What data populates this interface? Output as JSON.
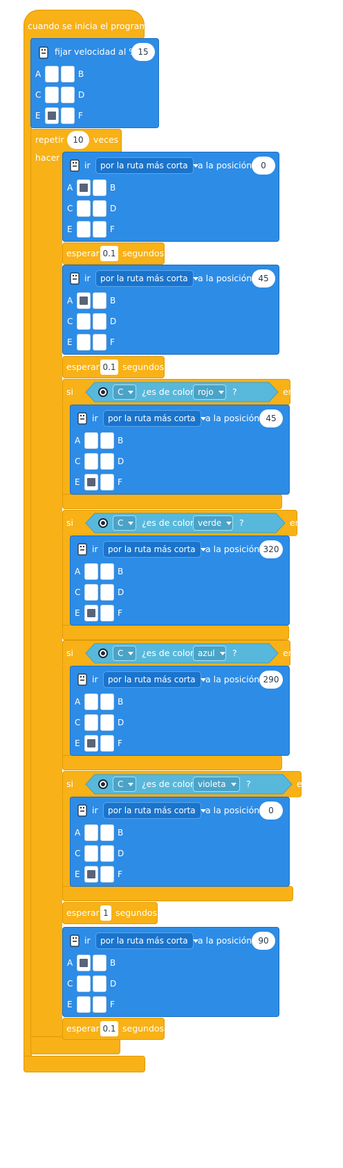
{
  "start": {
    "label": "cuando se inicia el programa"
  },
  "speed": {
    "label": "fijar velocidad al %",
    "value": "15",
    "ports": [
      {
        "letter": "A",
        "on": false
      },
      {
        "letter": "B",
        "on": false
      },
      {
        "letter": "C",
        "on": false
      },
      {
        "letter": "D",
        "on": false
      },
      {
        "letter": "E",
        "on": true
      },
      {
        "letter": "F",
        "on": false
      }
    ]
  },
  "repeat": {
    "label": "repetir",
    "count": "10",
    "unit": "veces",
    "do": "hacer"
  },
  "goto_common": {
    "verb": "ir",
    "mode": "por la ruta más corta",
    "to": "a la posición"
  },
  "wait_common": {
    "label": "esperar",
    "unit": "segundos"
  },
  "if_common": {
    "si": "si",
    "question": "¿es de color",
    "qmark": "?",
    "then": "entonces",
    "port": "C"
  },
  "moves": [
    {
      "position": "0",
      "active": "A"
    },
    {
      "position": "45",
      "active": "A"
    },
    {
      "position": "45",
      "active": "E"
    },
    {
      "position": "320",
      "active": "E"
    },
    {
      "position": "290",
      "active": "E"
    },
    {
      "position": "0",
      "active": "E"
    },
    {
      "position": "90",
      "active": "A"
    }
  ],
  "waits": [
    "0.1",
    "0.1",
    "1",
    "0.1"
  ],
  "ifs": [
    {
      "color": "rojo"
    },
    {
      "color": "verde"
    },
    {
      "color": "azul"
    },
    {
      "color": "violeta"
    }
  ],
  "port_letters": [
    "A",
    "B",
    "C",
    "D",
    "E",
    "F"
  ],
  "colors": {
    "event": "#f8b116",
    "motor": "#2d8ce6",
    "sensor": "#58b8dc",
    "port_on": "#5a6478"
  }
}
